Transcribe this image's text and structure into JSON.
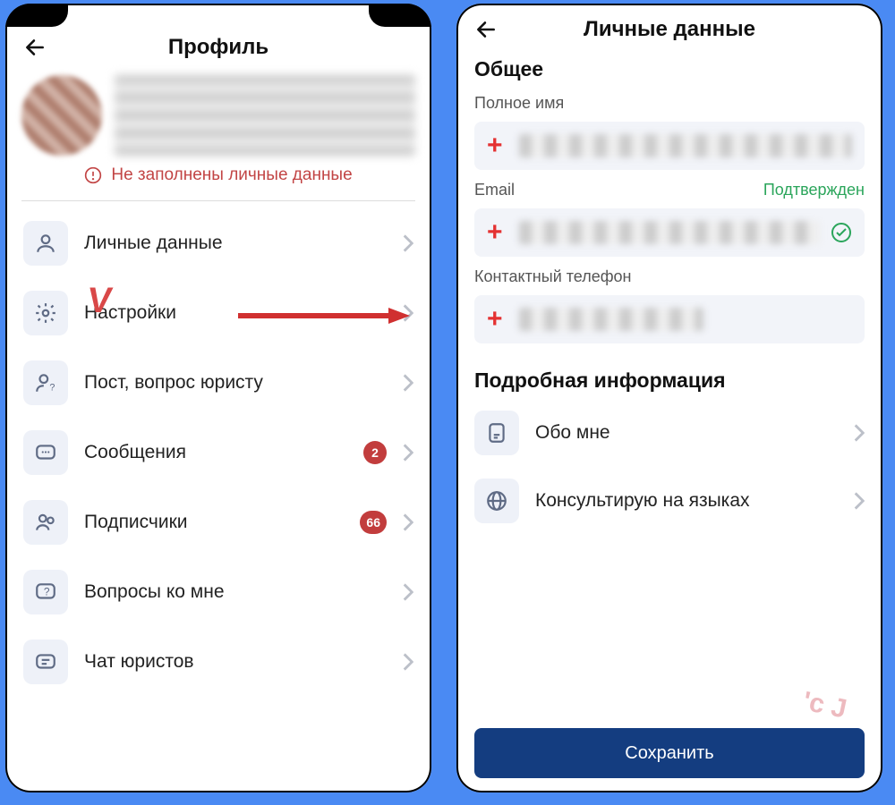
{
  "left": {
    "title": "Профиль",
    "warning": "Не заполнены личные данные",
    "menu": [
      {
        "key": "personal",
        "label": "Личные данные",
        "badge": null
      },
      {
        "key": "settings",
        "label": "Настройки",
        "badge": null
      },
      {
        "key": "post",
        "label": "Пост, вопрос юристу",
        "badge": null
      },
      {
        "key": "messages",
        "label": "Сообщения",
        "badge": "2"
      },
      {
        "key": "followers",
        "label": "Подписчики",
        "badge": "66"
      },
      {
        "key": "questions",
        "label": "Вопросы ко мне",
        "badge": null
      },
      {
        "key": "chat",
        "label": "Чат юристов",
        "badge": null
      }
    ]
  },
  "right": {
    "title": "Личные данные",
    "section_general": "Общее",
    "full_name_label": "Полное имя",
    "email_label": "Email",
    "email_verified": "Подтвержден",
    "phone_label": "Контактный телефон",
    "section_details": "Подробная информация",
    "details": [
      {
        "key": "about",
        "label": "Обо мне"
      },
      {
        "key": "langs",
        "label": "Консультирую на языках"
      }
    ],
    "save": "Сохранить"
  }
}
